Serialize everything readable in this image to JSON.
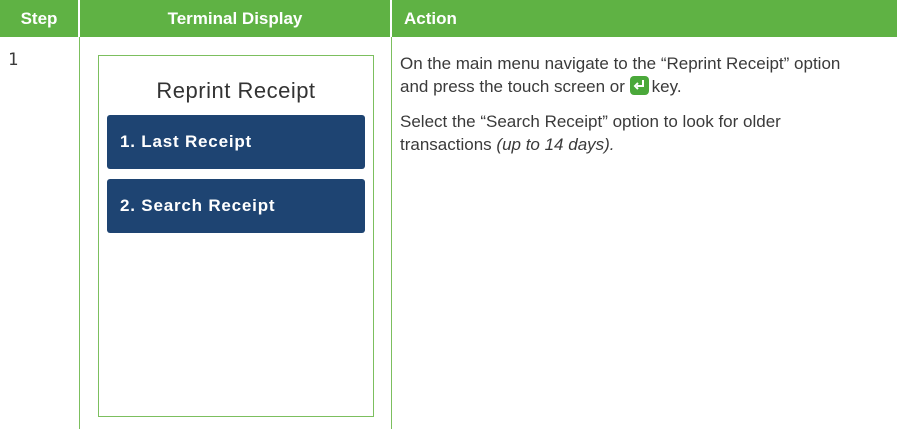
{
  "table": {
    "headers": {
      "step": "Step",
      "display": "Terminal Display",
      "action": "Action"
    },
    "rows": [
      {
        "step": "1",
        "terminal": {
          "title": "Reprint Receipt",
          "menu": [
            {
              "label": "1. Last Receipt"
            },
            {
              "label": "2. Search Receipt"
            }
          ]
        },
        "action": {
          "p1_text": "On the main menu navigate to the “Reprint Receipt” option and press the touch screen or",
          "p1_key_icon": "enter-key-icon",
          "p1_suffix": "key.",
          "p2_text": "Select the “Search Receipt” option to look for older transactions",
          "p2_note": "(up to 14 days)."
        }
      }
    ]
  },
  "colors": {
    "header_bg": "#5fb244",
    "button_bg": "#1e4472",
    "rule": "#7cbf5e",
    "enter_key": "#4aa83a"
  }
}
